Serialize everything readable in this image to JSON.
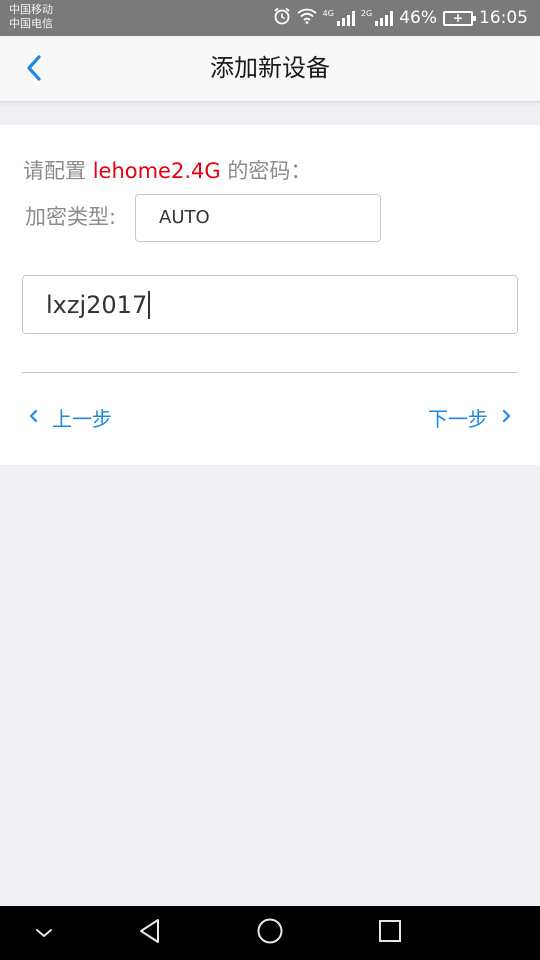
{
  "status_bar": {
    "carrier_1": "中国移动",
    "carrier_2": "中国电信",
    "net_1": "4G",
    "net_2": "2G",
    "battery_percent": "46%",
    "time": "16:05"
  },
  "header": {
    "title": "添加新设备",
    "back_icon": "chevron-left-icon"
  },
  "form": {
    "config_prefix": "请配置",
    "ssid": "lehome2.4G",
    "config_suffix": "的密码：",
    "encryption_label": "加密类型:",
    "encryption_value": "AUTO",
    "password_value": "lxzj2017"
  },
  "actions": {
    "prev_label": "上一步",
    "next_label": "下一步"
  },
  "colors": {
    "accent": "#1e88e5",
    "ssid": "#e60012",
    "header_bg": "#f8f8f8",
    "page_bg": "#efeff4"
  },
  "nav_bar": {
    "icons": [
      "chevron-down-icon",
      "back-triangle-icon",
      "home-circle-icon",
      "recents-square-icon"
    ]
  }
}
